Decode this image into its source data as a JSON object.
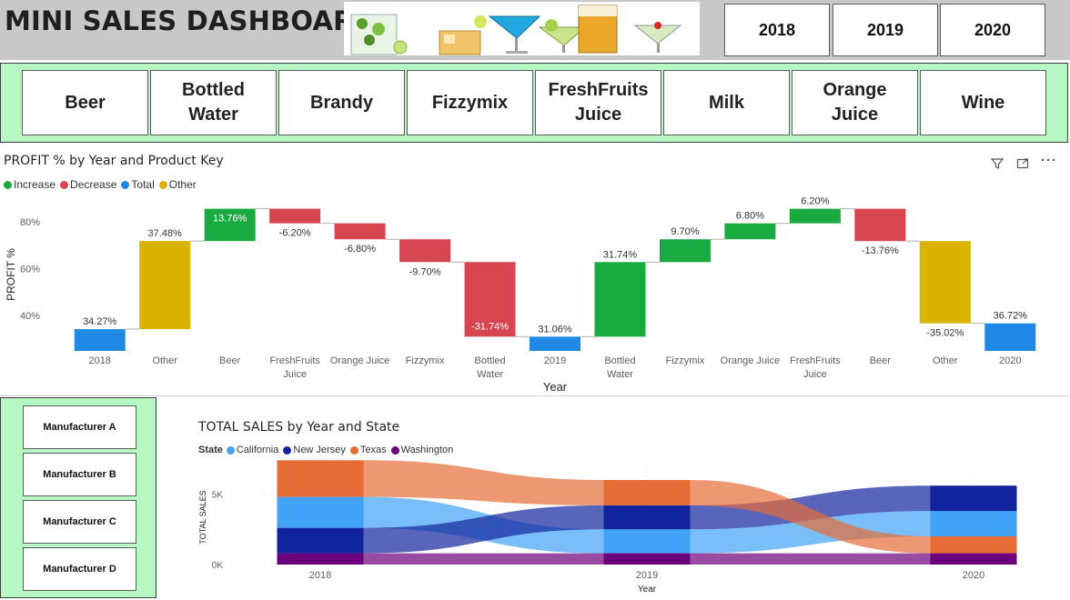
{
  "header": {
    "title": "MINI SALES DASHBOARD",
    "years": [
      "2018",
      "2019",
      "2020"
    ]
  },
  "products": [
    {
      "label": "Beer"
    },
    {
      "label": "Bottled Water"
    },
    {
      "label": "Brandy"
    },
    {
      "label": "Fizzymix"
    },
    {
      "label": "FreshFruits Juice"
    },
    {
      "label": "Milk"
    },
    {
      "label": "Orange Juice"
    },
    {
      "label": "Wine"
    }
  ],
  "manufacturers": [
    "Manufacturer A",
    "Manufacturer B",
    "Manufacturer C",
    "Manufacturer D"
  ],
  "colors": {
    "increase": "#1aab40",
    "decrease": "#d64550",
    "total": "#2089e6",
    "other": "#d9b300",
    "california": "#40a3f7",
    "new_jersey": "#12239e",
    "texas": "#e66c37",
    "washington": "#6b007b",
    "slicer_bg": "#b7f7c4",
    "header_bg": "#c8c8c8"
  },
  "chart_data": [
    {
      "type": "bar",
      "subtype": "waterfall",
      "title": "PROFIT % by Year and Product Key",
      "xlabel": "Year",
      "ylabel": "PROFIT %",
      "ylim": [
        25,
        90
      ],
      "y_ticks": [
        "40%",
        "60%",
        "80%"
      ],
      "legend": {
        "position": "top-left",
        "items": [
          {
            "name": "Increase",
            "color": "#1aab40"
          },
          {
            "name": "Decrease",
            "color": "#d64550"
          },
          {
            "name": "Total",
            "color": "#2089e6"
          },
          {
            "name": "Other",
            "color": "#d9b300"
          }
        ]
      },
      "bars": [
        {
          "category": "2018",
          "kind": "total",
          "start": 0,
          "end": 34.27,
          "label": "34.27%"
        },
        {
          "category": "Other",
          "kind": "other",
          "start": 34.27,
          "end": 71.75,
          "label": "37.48%"
        },
        {
          "category": "Beer",
          "kind": "increase",
          "start": 71.75,
          "end": 85.51,
          "label": "13.76%"
        },
        {
          "category": "FreshFruits Juice",
          "kind": "decrease",
          "start": 85.51,
          "end": 79.31,
          "label": "-6.20%"
        },
        {
          "category": "Orange Juice",
          "kind": "decrease",
          "start": 79.31,
          "end": 72.51,
          "label": "-6.80%"
        },
        {
          "category": "Fizzymix",
          "kind": "decrease",
          "start": 72.51,
          "end": 62.81,
          "label": "-9.70%"
        },
        {
          "category": "Bottled Water",
          "kind": "decrease",
          "start": 62.81,
          "end": 31.07,
          "label": "-31.74%"
        },
        {
          "category": "2019",
          "kind": "total",
          "start": 0,
          "end": 31.06,
          "label": "31.06%"
        },
        {
          "category": "Bottled Water",
          "kind": "increase",
          "start": 31.06,
          "end": 62.8,
          "label": "31.74%"
        },
        {
          "category": "Fizzymix",
          "kind": "increase",
          "start": 62.8,
          "end": 72.5,
          "label": "9.70%"
        },
        {
          "category": "Orange Juice",
          "kind": "increase",
          "start": 72.5,
          "end": 79.3,
          "label": "6.80%"
        },
        {
          "category": "FreshFruits Juice",
          "kind": "increase",
          "start": 79.3,
          "end": 85.5,
          "label": "6.20%"
        },
        {
          "category": "Beer",
          "kind": "decrease",
          "start": 85.5,
          "end": 71.74,
          "label": "-13.76%"
        },
        {
          "category": "Other",
          "kind": "other",
          "start": 71.74,
          "end": 36.72,
          "label": "-35.02%"
        },
        {
          "category": "2020",
          "kind": "total",
          "start": 0,
          "end": 36.72,
          "label": "36.72%"
        }
      ]
    },
    {
      "type": "area",
      "subtype": "ribbon",
      "title": "TOTAL SALES by Year and State",
      "xlabel": "Year",
      "ylabel": "TOTAL SALES",
      "categories": [
        "2018",
        "2019",
        "2020"
      ],
      "ylim": [
        0,
        8000
      ],
      "y_ticks": [
        "0K",
        "5K"
      ],
      "legend": {
        "title": "State",
        "position": "top-left"
      },
      "series": [
        {
          "name": "California",
          "color": "#40a3f7",
          "values": [
            2200,
            1700,
            1800
          ]
        },
        {
          "name": "New Jersey",
          "color": "#12239e",
          "values": [
            1800,
            1700,
            1800
          ]
        },
        {
          "name": "Texas",
          "color": "#e66c37",
          "values": [
            2600,
            1800,
            1200
          ]
        },
        {
          "name": "Washington",
          "color": "#6b007b",
          "values": [
            800,
            800,
            800
          ]
        }
      ],
      "stack_order": [
        [
          "Washington",
          "New Jersey",
          "California",
          "Texas"
        ],
        [
          "Washington",
          "California",
          "New Jersey",
          "Texas"
        ],
        [
          "Washington",
          "Texas",
          "California",
          "New Jersey"
        ]
      ]
    }
  ]
}
